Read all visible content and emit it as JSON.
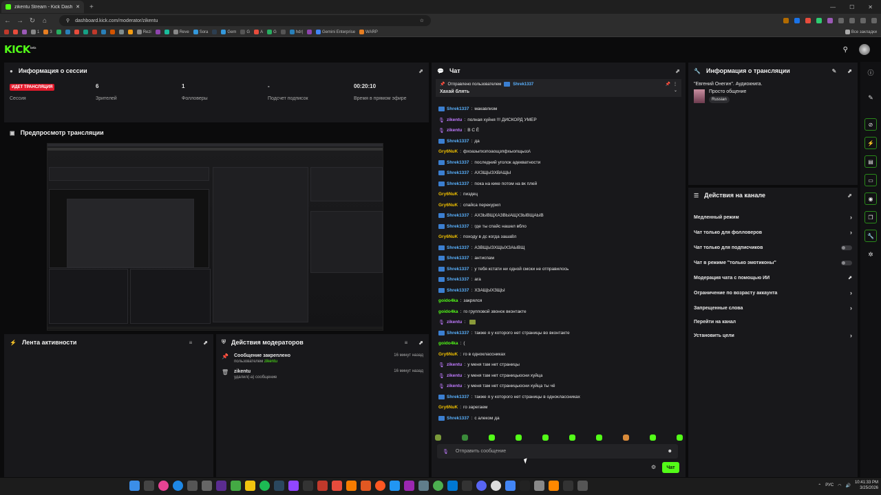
{
  "browser": {
    "tab_title": "zikentu Stream - Kick Dashbo",
    "url": "dashboard.kick.com/moderator/zikentu",
    "bookmarks": [
      "1",
      "3",
      "Rezi",
      "Reve",
      "Sora",
      "Gem",
      "G",
      "A",
      "G",
      "hdr|",
      "Gemini Enterprise",
      "WARP"
    ],
    "bookmarks_all": "Все закладки"
  },
  "kick": {
    "logo": "KICK",
    "logo_sup": "beta"
  },
  "session": {
    "title": "Информация о сессии",
    "live_badge": "ИДЕТ ТРАНСЛЯЦИЯ",
    "live_label": "Сессия",
    "viewers": "6",
    "viewers_label": "Зрителей",
    "followers": "1",
    "followers_label": "Фолловеры",
    "subs": "-",
    "subs_label": "Подсчет подписок",
    "uptime": "00:20:10",
    "uptime_label": "Время в прямом эфире"
  },
  "preview": {
    "title": "Предпросмотр трансляции"
  },
  "activity": {
    "title": "Лента активности"
  },
  "modactions": {
    "title": "Действия модераторов",
    "entries": [
      {
        "title": "Сообщение закреплено",
        "sub_prefix": "пользователем",
        "user": "zikentu",
        "time": "16 минут назад"
      },
      {
        "title": "zikentu",
        "sub": "удалил(-а) сообщение",
        "time": "16 минут назад"
      }
    ]
  },
  "chat": {
    "title": "Чат",
    "pinned": {
      "by_label": "Отправлено пользователем",
      "by_user": "Shrek1337",
      "message": "Хахай блять"
    },
    "messages": [
      {
        "user": "Shrek1337",
        "text": "макавлизм",
        "kind": "shrek"
      },
      {
        "user": "zikentu",
        "text": "полная хуйня !!! ДИСКОРД УМЕР",
        "kind": "zik"
      },
      {
        "user": "zikentu",
        "text": "В С Ё",
        "kind": "zik"
      },
      {
        "user": "Shrek1337",
        "text": "да",
        "kind": "shrek"
      },
      {
        "user": "Gry6NuK",
        "text": "фхоазыпхзпоаощзпфхыопщызэ\\",
        "kind": "gry"
      },
      {
        "user": "Shrek1337",
        "text": "последний уголок адекватности",
        "kind": "shrek"
      },
      {
        "user": "Shrek1337",
        "text": "АХЗЩЫЗХВАЩЫ",
        "kind": "shrek"
      },
      {
        "user": "Shrek1337",
        "text": "пока на кике потом на вк плей",
        "kind": "shrek"
      },
      {
        "user": "Gry6NuK",
        "text": "пиздец",
        "kind": "gry"
      },
      {
        "user": "Gry6NuK",
        "text": "спайса перекурил",
        "kind": "gry"
      },
      {
        "user": "Shrek1337",
        "text": "АХЗЫВЩХАЗВЫАЩХЗЫВЩАЫВ",
        "kind": "shrek"
      },
      {
        "user": "Shrek1337",
        "text": "где ты спайс нашел вбло",
        "kind": "shrek"
      },
      {
        "user": "Gry6NuK",
        "text": "походу в дс когда заша8л",
        "kind": "gry"
      },
      {
        "user": "Shrek1337",
        "text": "АЗВЩЫЗХЩЫХЗАЫВЩ",
        "kind": "shrek"
      },
      {
        "user": "Shrek1337",
        "text": "антиспам",
        "kind": "shrek"
      },
      {
        "user": "Shrek1337",
        "text": "у тебя кстати ни одной смски не отправилось",
        "kind": "shrek"
      },
      {
        "user": "Shrek1337",
        "text": "ага",
        "kind": "shrek"
      },
      {
        "user": "Shrek1337",
        "text": "ХЗАЩЫХЗЩЫ",
        "kind": "shrek"
      },
      {
        "user": "goido4ka",
        "text": "закрялся",
        "kind": "goido"
      },
      {
        "user": "goido4ka",
        "text": "го групповой звонок вконтакте",
        "kind": "goido"
      },
      {
        "user": "zikentu",
        "text": "",
        "kind": "zik"
      },
      {
        "user": "Shrek1337",
        "text": "также я у которого нет страницы во вконтакте",
        "kind": "shrek"
      },
      {
        "user": "goido4ka",
        "text": "(",
        "kind": "goido"
      },
      {
        "user": "Gry6NuK",
        "text": "го в одноклассниках",
        "kind": "gry"
      },
      {
        "user": "zikentu",
        "text": "у меня там нет страницы",
        "kind": "zik"
      },
      {
        "user": "zikentu",
        "text": "у меня там нет страницыосни хуйца",
        "kind": "zik"
      },
      {
        "user": "zikentu",
        "text": "у меня там нет страницыосни хуйца ты чё",
        "kind": "zik"
      },
      {
        "user": "Shrek1337",
        "text": "также я у которого нет страницы в одноклассниках",
        "kind": "shrek"
      },
      {
        "user": "Gry6NuK",
        "text": "го зарегаем",
        "kind": "gry"
      },
      {
        "user": "Shrek1337",
        "text": "с алеком да",
        "kind": "shrek"
      }
    ],
    "input_placeholder": "Отправить сообщение",
    "send_label": "Чат"
  },
  "stream_info": {
    "title": "Информация о трансляции",
    "stream_title": "\"Евгений Онегин\". Аудиокнига.",
    "category": "Просто общение",
    "language": "Russian"
  },
  "channel_actions": {
    "title": "Действия на канале",
    "items": [
      {
        "label": "Медленный режим",
        "control": "chevron"
      },
      {
        "label": "Чат только для фолловеров",
        "control": "chevron"
      },
      {
        "label": "Чат только для подписчиков",
        "control": "toggle"
      },
      {
        "label": "Чат в режиме \"только эмотиконы\"",
        "control": "toggle"
      },
      {
        "label": "Модерация чата с помощью ИИ",
        "control": "external"
      },
      {
        "label": "Ограничение по возрасту аккаунта",
        "control": "chevron"
      },
      {
        "label": "Запрещенные слова",
        "control": "chevron"
      },
      {
        "label": "Перейти на канал",
        "control": "none"
      },
      {
        "label": "Установить цели",
        "control": "chevron"
      }
    ]
  },
  "taskbar": {
    "lang": "РУС",
    "time": "10:41:33 PM",
    "date": "3/25/2026"
  },
  "colors": {
    "accent": "#53fc18",
    "live": "#e3192b",
    "panel": "#18181b",
    "background": "#0b0b0c"
  }
}
